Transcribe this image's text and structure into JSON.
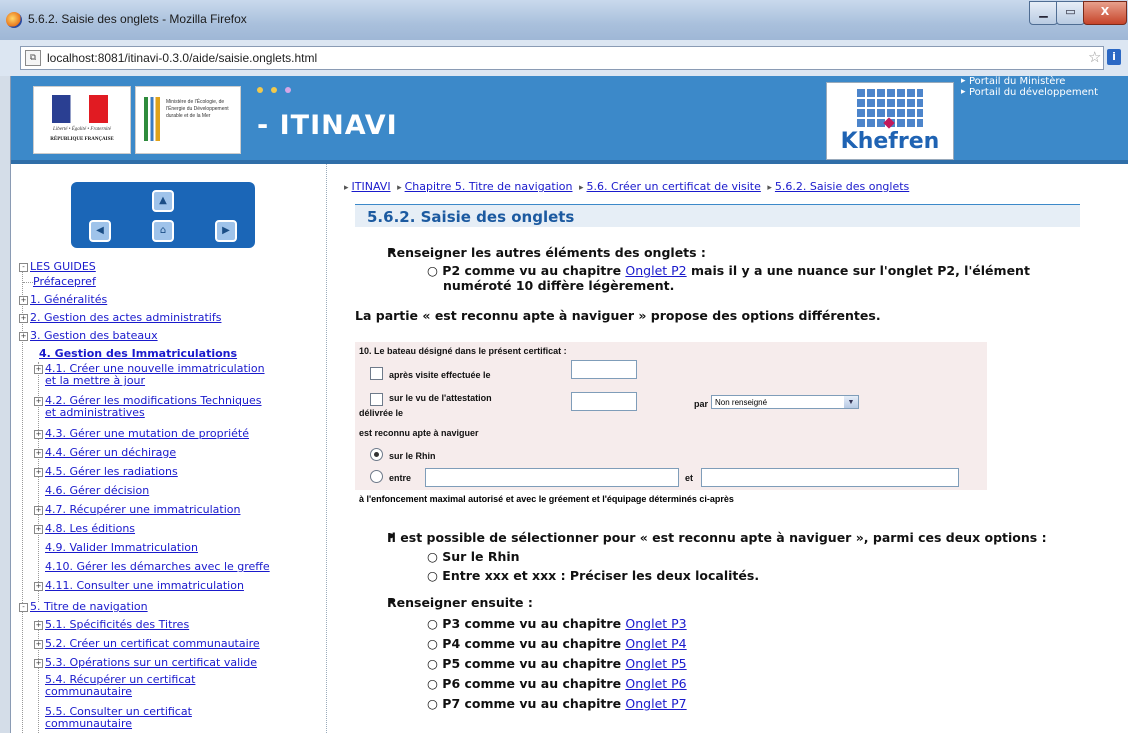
{
  "window": {
    "title": "5.6.2. Saisie des onglets - Mozilla Firefox",
    "min_label": "▁",
    "max_label": "▭",
    "close_label": "X"
  },
  "address": {
    "url": "localhost:8081/itinavi-0.3.0/aide/saisie.onglets.html",
    "site_icon": "page-icon",
    "star": "☆",
    "info": "i"
  },
  "banner": {
    "app_title": "- ITINAVI",
    "rf_motto": "Liberté • Égalité • Fraternité",
    "rf_name": "RÉPUBLIQUE FRANÇAISE",
    "ministry_text": "Ministère de l'Écologie, de l'Énergie du Développement durable et de la Mer",
    "khefren_label": "Khefren",
    "portals": [
      "Portail du Ministère",
      "Portail du développement"
    ]
  },
  "nav_buttons": {
    "up": "▲",
    "left": "◀",
    "home": "⌂",
    "right": "▶"
  },
  "tree": {
    "root": "LES GUIDES",
    "items": [
      {
        "label": "Préfacepref",
        "toggle": ""
      },
      {
        "label": "1. Généralités",
        "toggle": "+"
      },
      {
        "label": "2. Gestion des actes administratifs",
        "toggle": "+"
      },
      {
        "label": "3. Gestion des bateaux",
        "toggle": "+"
      },
      {
        "label": "4. Gestion des Immatriculations",
        "toggle": ""
      },
      {
        "label": "4.1. Créer une nouvelle immatriculation",
        "label2": "et la mettre à jour",
        "toggle": "+"
      },
      {
        "label": "4.2. Gérer les modifications Techniques",
        "label2": "et administratives",
        "toggle": "+"
      },
      {
        "label": "4.3. Gérer une mutation de propriété",
        "toggle": "+"
      },
      {
        "label": "4.4. Gérer un déchirage",
        "toggle": "+"
      },
      {
        "label": "4.5. Gérer les radiations",
        "toggle": "+"
      },
      {
        "label": "4.6. Gérer décision",
        "toggle": ""
      },
      {
        "label": "4.7. Récupérer une immatriculation",
        "toggle": "+"
      },
      {
        "label": "4.8. Les éditions",
        "toggle": "+"
      },
      {
        "label": "4.9. Valider Immatriculation",
        "toggle": ""
      },
      {
        "label": "4.10. Gérer les démarches avec le greffe",
        "toggle": ""
      },
      {
        "label": "4.11. Consulter une immatriculation",
        "toggle": "+"
      },
      {
        "label": "5. Titre de navigation",
        "toggle": "-"
      },
      {
        "label": "5.1. Spécificités des Titres",
        "toggle": "+"
      },
      {
        "label": "5.2. Créer un certificat communautaire",
        "toggle": "+"
      },
      {
        "label": "5.3. Opérations sur un certificat valide",
        "toggle": "+"
      },
      {
        "label": "5.4. Récupérer un certificat",
        "label2": "communautaire",
        "toggle": ""
      },
      {
        "label": "5.5. Consulter un certificat",
        "label2": "communautaire",
        "toggle": ""
      }
    ]
  },
  "breadcrumb": [
    "ITINAVI",
    "Chapitre 5.  Titre de navigation",
    "5.6.  Créer un certificat de visite",
    "5.6.2.  Saisie des onglets"
  ],
  "page": {
    "heading": "5.6.2.  Saisie des onglets",
    "b1": "Renseigner les autres éléments des onglets :",
    "b1_sub_a": "P2 comme vu au chapitre ",
    "b1_sub_link": "Onglet P2",
    "b1_sub_b": " mais il y a une nuance sur l'onglet P2, l'élément",
    "b1_sub_c": "numéroté 10 diffère légèrement.",
    "para": "La partie « est reconnu apte à naviguer » propose des options différentes.",
    "b2": "Il est possible de sélectionner pour « est reconnu apte à naviguer », parmi ces deux options :",
    "b2_items": [
      "Sur le Rhin",
      "Entre xxx et xxx : Préciser les deux localités."
    ],
    "b3": "Renseigner ensuite :",
    "b3_items": [
      {
        "text": "P3 comme vu au chapitre ",
        "link": "Onglet P3"
      },
      {
        "text": "P4 comme vu au chapitre ",
        "link": "Onglet P4"
      },
      {
        "text": "P5 comme vu au chapitre ",
        "link": "Onglet P5"
      },
      {
        "text": "P6 comme vu au chapitre ",
        "link": "Onglet P6"
      },
      {
        "text": "P7 comme vu au chapitre ",
        "link": "Onglet P7"
      }
    ]
  },
  "form": {
    "title": "10. Le bateau désigné dans le présent certificat :",
    "cb1": "après visite effectuée le",
    "cb2a": "sur le vu de l'attestation",
    "cb2b": "délivrée le",
    "par": "par",
    "select_value": "Non renseigné",
    "apte": "est reconnu apte à naviguer",
    "r1": "sur le Rhin",
    "r2": "entre",
    "et": "et",
    "footer": "à l'enfoncement maximal autorisé et avec le gréement et l'équipage déterminés ci-après"
  }
}
